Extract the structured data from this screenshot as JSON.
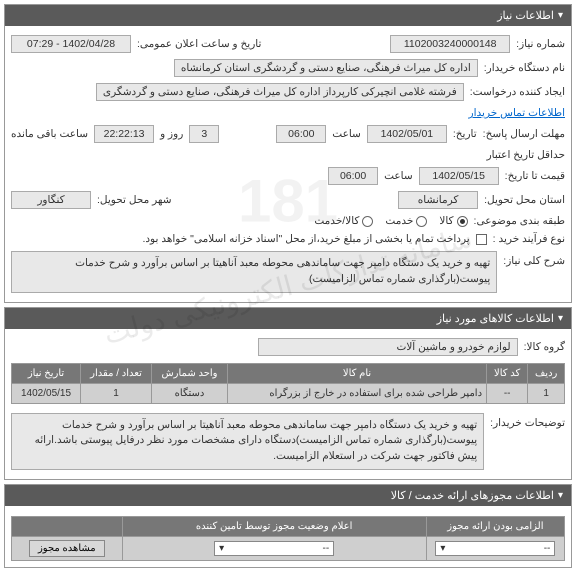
{
  "panel1": {
    "title": "اطلاعات نیاز",
    "need_no_label": "شماره نیاز:",
    "need_no": "1102003240000148",
    "announce_label": "تاریخ و ساعت اعلان عمومی:",
    "announce": "1402/04/28 - 07:29",
    "buyer_label": "نام دستگاه خریدار:",
    "buyer": "اداره کل میراث فرهنگی، صنایع دستی و گردشگری استان کرمانشاه",
    "requester_label": "ایجاد کننده درخواست:",
    "requester": "فرشته غلامی انچیرکی کارپرداز اداره کل میراث فرهنگی، صنایع دستی و گردشگری",
    "contact_link": "اطلاعات تماس خریدار",
    "deadline_label": "مهلت ارسال پاسخ:",
    "deadline_date_label": "تاریخ:",
    "deadline_date": "1402/05/01",
    "time_label": "ساعت",
    "deadline_time": "06:00",
    "days_label": "روز و",
    "days": "3",
    "remain_label": "ساعت باقی مانده",
    "remain": "22:22:13",
    "validity_label": "حداقل تاریخ اعتبار",
    "validity_sub": "قیمت تا تاریخ:",
    "validity_date": "1402/05/15",
    "validity_time": "06:00",
    "province_label": "استان محل تحویل:",
    "province": "کرمانشاه",
    "city_label": "شهر محل تحویل:",
    "city": "کنگاور",
    "category_label": "طبقه بندی موضوعی:",
    "cat_goods": "کالا",
    "cat_service": "خدمت",
    "cat_both": "کالا/خدمت",
    "process_label": "نوع فرآیند خرید :",
    "pay_note": "پرداخت تمام یا بخشی از مبلغ خرید،از محل \"اسناد خزانه اسلامی\" خواهد بود.",
    "desc_label": "شرح کلی نیاز:",
    "desc": "تهیه و خرید یک دستگاه دامپر جهت ساماندهی محوطه معبد آناهیتا بر اساس برآورد و شرح خدمات پیوست(بارگذاری شماره تماس الزامیست)"
  },
  "panel2": {
    "title": "اطلاعات کالاهای مورد نیاز",
    "group_label": "گروه کالا:",
    "group": "لوازم خودرو و ماشین آلات",
    "headers": [
      "ردیف",
      "کد کالا",
      "نام کالا",
      "واحد شمارش",
      "تعداد / مقدار",
      "تاریخ نیاز"
    ],
    "rows": [
      {
        "r": "1",
        "code": "--",
        "name": "دامپر طراحی شده برای استفاده در خارج از بزرگراه",
        "unit": "دستگاه",
        "qty": "1",
        "date": "1402/05/15"
      }
    ],
    "buyer_notes_label": "توضیحات خریدار:",
    "buyer_notes": "تهیه و خرید یک دستگاه دامپر جهت ساماندهی محوطه معبد آناهیتا بر اساس برآورد و شرح خدمات پیوست(بارگذاری شماره تماس الزامیست)دستگاه دارای مشخصات مورد نظر درفایل پیوستی باشد.ارائه پیش فاکتور جهت شرکت در استعلام الزامیست."
  },
  "panel3": {
    "title": "اطلاعات مجوزهای ارائه خدمت / کالا",
    "headers": [
      "الزامی بودن ارائه مجوز",
      "اعلام وضعیت مجوز توسط تامین کننده",
      ""
    ],
    "select_placeholder": "--",
    "btn_view": "مشاهده مجوز"
  }
}
